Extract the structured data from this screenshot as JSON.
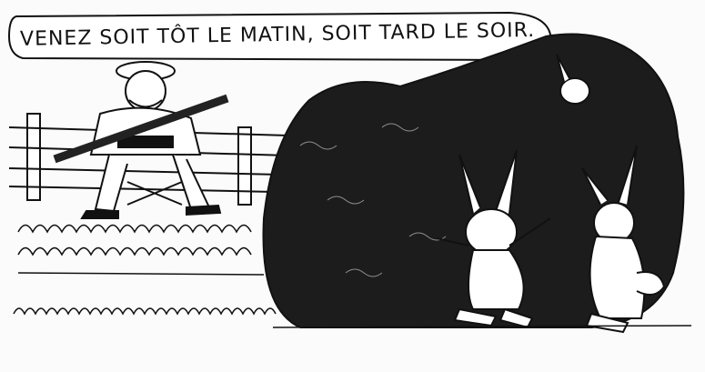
{
  "speech_balloon": {
    "text": "VENEZ SOIT TÔT LE MATIN, SOIT TARD LE SOIR."
  },
  "colors": {
    "ink": "#111111",
    "paper": "#fbfbfb",
    "bush": "#1c1c1c"
  }
}
